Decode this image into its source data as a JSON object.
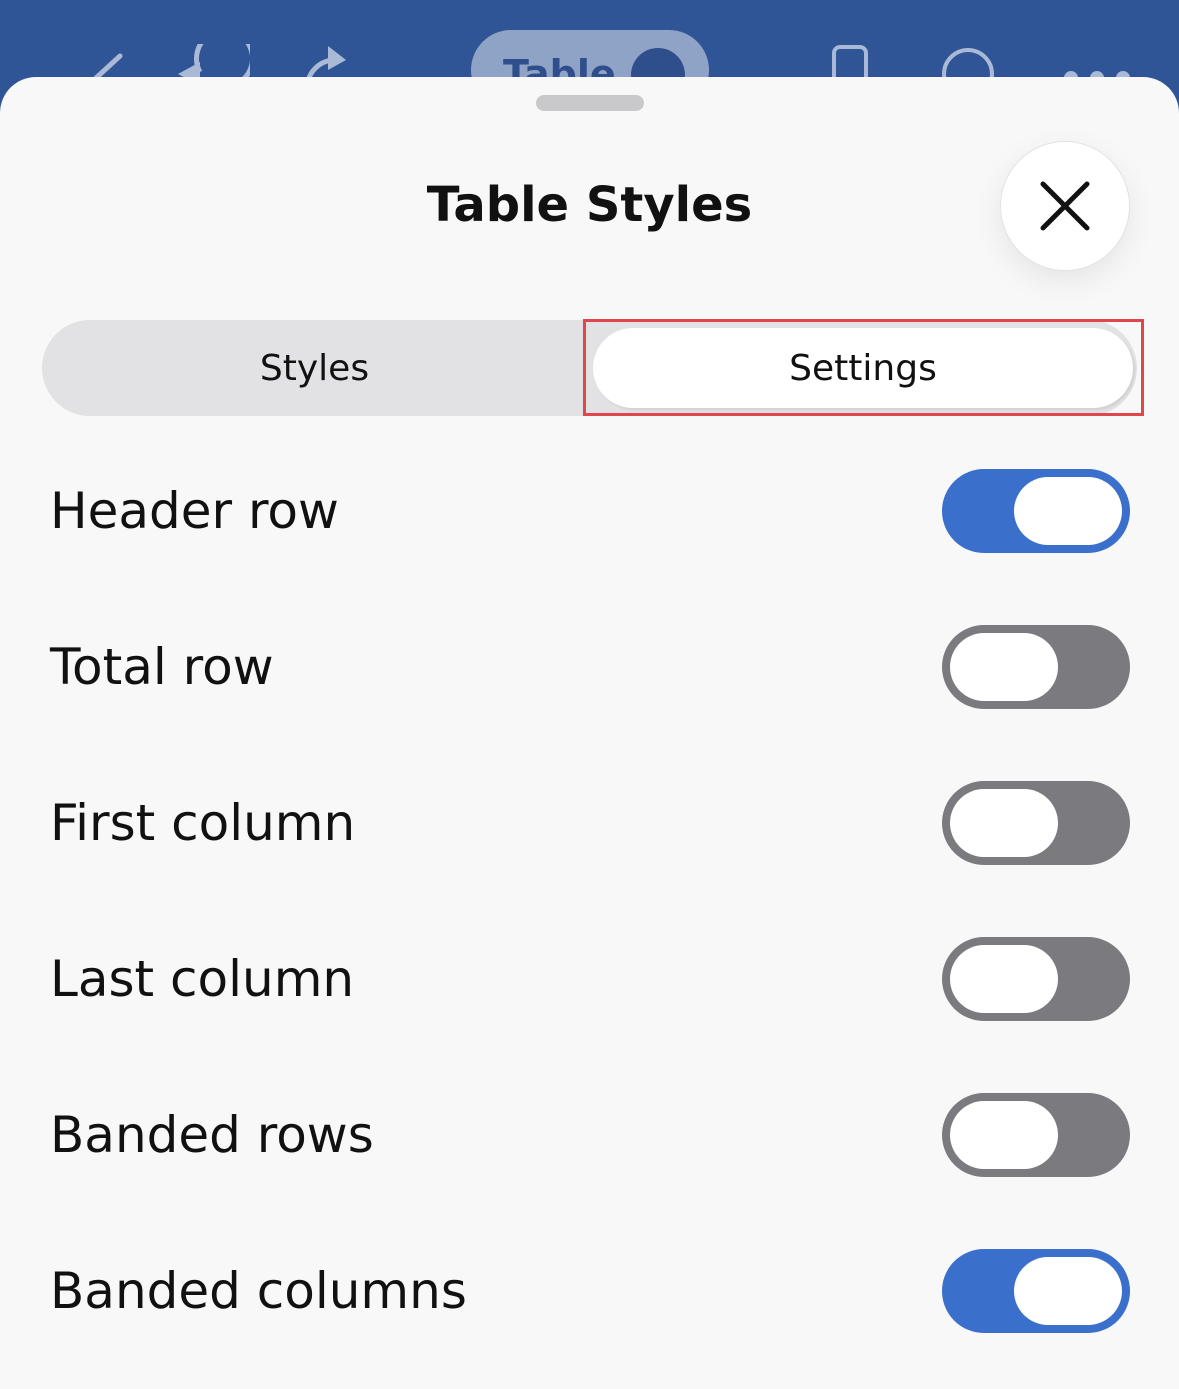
{
  "app_toolbar": {
    "pill_label": "Table",
    "icons": [
      "back-icon",
      "undo-icon",
      "redo-icon",
      "share-icon",
      "phone-view-icon",
      "comment-icon",
      "more-icon"
    ]
  },
  "sheet": {
    "title": "Table Styles",
    "close_icon": "close-icon"
  },
  "tabs": [
    {
      "label": "Styles",
      "selected": false
    },
    {
      "label": "Settings",
      "selected": true
    }
  ],
  "options": [
    {
      "label": "Header row",
      "on": true
    },
    {
      "label": "Total row",
      "on": false
    },
    {
      "label": "First column",
      "on": false
    },
    {
      "label": "Last column",
      "on": false
    },
    {
      "label": "Banded rows",
      "on": false
    },
    {
      "label": "Banded columns",
      "on": true
    }
  ],
  "colors": {
    "toolbar": "#2f5596",
    "toggle_on": "#3a6fcb",
    "toggle_off": "#7a7a7f",
    "highlight": "#e0474c"
  }
}
